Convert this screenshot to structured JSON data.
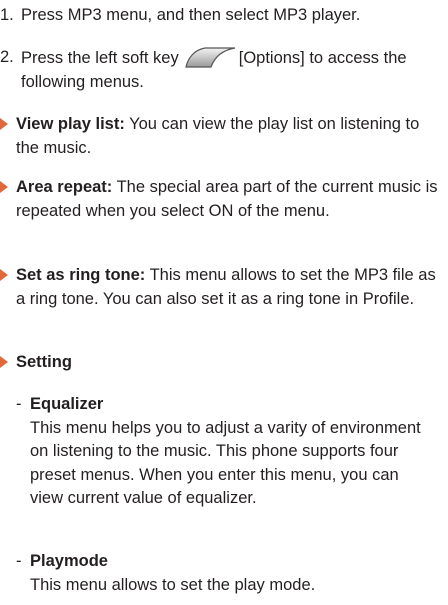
{
  "steps": [
    {
      "num": "1.",
      "text": "Press MP3 menu, and then select MP3 player."
    },
    {
      "num": "2.",
      "text_before": "Press the left soft key",
      "text_after": "[Options] to access the following menus."
    }
  ],
  "bullets": [
    {
      "title": "View play list:",
      "text": " You can view the play list on listening to the music."
    },
    {
      "title": "Area repeat:",
      "text": " The special area part of the current music is repeated when you select ON of the menu."
    },
    {
      "title": "Set as ring tone:",
      "text": " This menu allows to set the MP3 file as a ring tone. You can also set it as a ring tone in Profile."
    },
    {
      "title": "Setting",
      "text": ""
    }
  ],
  "settings": [
    {
      "dash": "-",
      "title": "Equalizer",
      "text": "This menu helps you to adjust a varity of environment on listening to the music. This phone supports four preset menus. When you enter this menu, you can view current value of equalizer."
    },
    {
      "dash": "-",
      "title": "Playmode",
      "text": "This menu allows to set the play mode."
    }
  ],
  "colors": {
    "bullet": "#e2683c",
    "text": "#231f20"
  },
  "icons": {
    "soft_key": "left-soft-key-icon",
    "bullet": "triangle-bullet-icon"
  }
}
